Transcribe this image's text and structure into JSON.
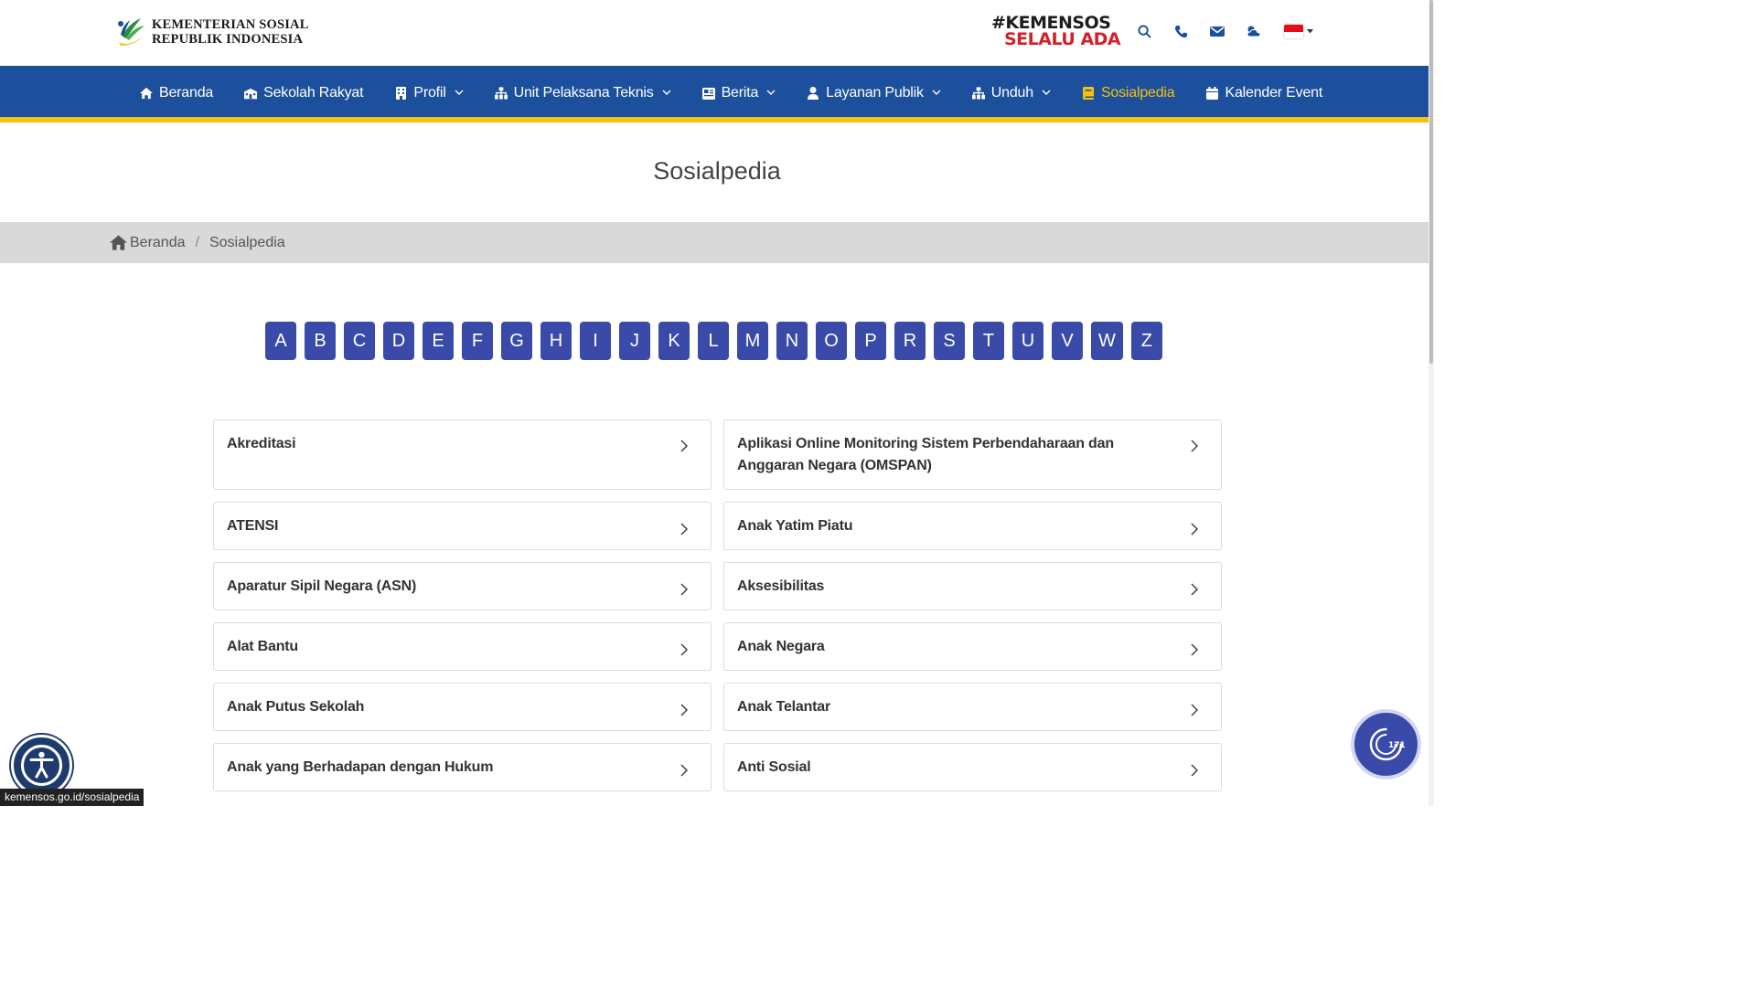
{
  "header": {
    "logo_line1": "KEMENTERIAN SOSIAL",
    "logo_line2": "REPUBLIK INDONESIA",
    "hashtag_line1": "#KEMENSOS",
    "hashtag_line2": "SELALU ADA",
    "icons": [
      "search-icon",
      "phone-icon",
      "mail-icon",
      "weather-icon",
      "flag-id-icon"
    ]
  },
  "nav": {
    "items": [
      {
        "label": "Beranda",
        "icon": "home-icon",
        "dropdown": false
      },
      {
        "label": "Sekolah Rakyat",
        "icon": "school-icon",
        "dropdown": false
      },
      {
        "label": "Profil",
        "icon": "building-icon",
        "dropdown": true
      },
      {
        "label": "Unit Pelaksana Teknis",
        "icon": "sitemap-icon",
        "dropdown": true
      },
      {
        "label": "Berita",
        "icon": "newspaper-icon",
        "dropdown": true
      },
      {
        "label": "Layanan Publik",
        "icon": "user-icon",
        "dropdown": true
      },
      {
        "label": "Unduh",
        "icon": "sitemap-icon",
        "dropdown": true
      },
      {
        "label": "Sosialpedia",
        "icon": "book-icon",
        "dropdown": false,
        "active": true
      },
      {
        "label": "Kalender Event",
        "icon": "calendar-icon",
        "dropdown": false
      }
    ]
  },
  "page": {
    "title": "Sosialpedia"
  },
  "breadcrumb": {
    "home": "Beranda",
    "sep": "/",
    "current": "Sosialpedia"
  },
  "alphabet": [
    "A",
    "B",
    "C",
    "D",
    "E",
    "F",
    "G",
    "H",
    "I",
    "J",
    "K",
    "L",
    "M",
    "N",
    "O",
    "P",
    "R",
    "S",
    "T",
    "U",
    "V",
    "W",
    "Z"
  ],
  "entries": [
    [
      "Akreditasi",
      "Aplikasi Online Monitoring Sistem Perbendaharaan dan Anggaran Negara (OMSPAN)"
    ],
    [
      "ATENSI",
      "Anak Yatim Piatu"
    ],
    [
      "Aparatur Sipil Negara (ASN)",
      "Aksesibilitas"
    ],
    [
      "Alat Bantu",
      "Anak Negara"
    ],
    [
      "Anak Putus Sekolah",
      "Anak Telantar"
    ],
    [
      "Anak yang Berhadapan dengan Hukum",
      "Anti Sosial"
    ]
  ],
  "status_url": "kemensos.go.id/sosialpedia",
  "colors": {
    "nav_bg": "#1c4f9c",
    "nav_accent": "#f4c10f",
    "alpha_btn": "#3a4aa8",
    "hashtag_red": "#d3202a"
  }
}
